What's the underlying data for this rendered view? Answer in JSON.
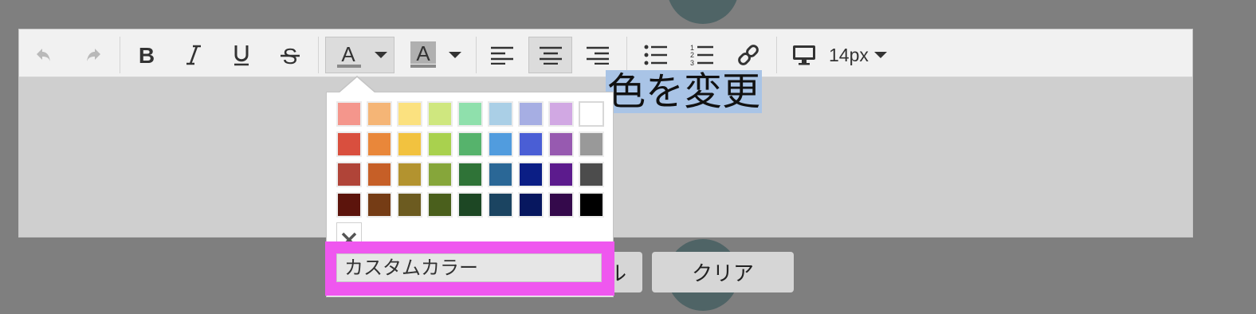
{
  "editor": {
    "content_text": "色を変更"
  },
  "toolbar": {
    "font_size": "14px"
  },
  "color_picker": {
    "swatches": [
      [
        "#f4968c",
        "#f5b576",
        "#fbe17f",
        "#cfe77f",
        "#8fe0ac",
        "#aacfe6",
        "#a6aee3",
        "#d1a8e3",
        "#ffffff"
      ],
      [
        "#d94f3e",
        "#e9873a",
        "#f2c23f",
        "#a9d14e",
        "#56b36c",
        "#519cde",
        "#4a5ed5",
        "#975ab0",
        "#999999"
      ],
      [
        "#b04438",
        "#c65f27",
        "#b3932f",
        "#86a63a",
        "#2f7337",
        "#2a6796",
        "#0b1e85",
        "#5c1b8d",
        "#4c4c4c"
      ],
      [
        "#5c140c",
        "#753c15",
        "#6c5b20",
        "#4a5f1c",
        "#1d4724",
        "#1b4461",
        "#07175f",
        "#34094b",
        "#000000"
      ]
    ],
    "custom_color_label": "カスタムカラー"
  },
  "buttons": {
    "cancel_label": "ル",
    "clear_label": "クリア"
  }
}
